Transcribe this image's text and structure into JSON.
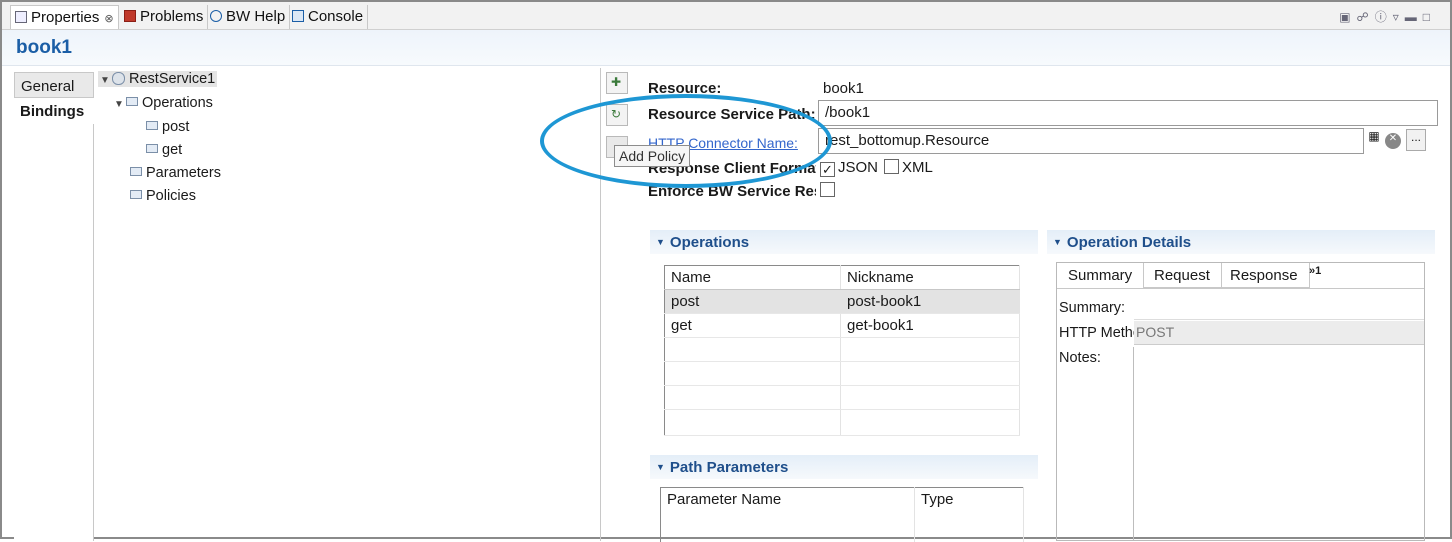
{
  "view_tabs": [
    {
      "label": "Properties",
      "close": "⊗",
      "active": true
    },
    {
      "label": "Problems"
    },
    {
      "label": "BW Help"
    },
    {
      "label": "Console"
    }
  ],
  "top_icons": [
    "view-menu-icon",
    "pin-icon",
    "help-icon",
    "minimize-icon",
    "maximize-icon"
  ],
  "title": "book1",
  "left_tabs": [
    "General",
    "Bindings"
  ],
  "tree": [
    {
      "label": "RestService1",
      "level": 0,
      "icon": "rest-service-icon",
      "expanded": true,
      "selected": true
    },
    {
      "label": "Operations",
      "level": 1,
      "icon": "operations-icon",
      "expanded": true
    },
    {
      "label": "post",
      "level": 2,
      "icon": "operation-icon"
    },
    {
      "label": "get",
      "level": 2,
      "icon": "operation-icon"
    },
    {
      "label": "Parameters",
      "level": 1,
      "icon": "parameters-icon"
    },
    {
      "label": "Policies",
      "level": 1,
      "icon": "policies-icon"
    }
  ],
  "tooltip": "Add Policy",
  "form": {
    "resource_label": "Resource:",
    "resource_value": "book1",
    "path_label": "Resource Service Path:",
    "path_value": "/book1",
    "connector_label": "HTTP Connector Name:",
    "connector_value": "rest_bottomup.Resource",
    "format_label": "Response Client Format",
    "json_label": "JSON",
    "json_checked": true,
    "xml_label": "XML",
    "xml_checked": false,
    "enforce_label": "Enforce BW Service Res",
    "enforce_checked": false,
    "browse_label": "..."
  },
  "operations_section": {
    "title": "Operations",
    "columns": [
      "Name",
      "Nickname"
    ],
    "rows": [
      {
        "name": "post",
        "nickname": "post-book1",
        "selected": true
      },
      {
        "name": "get",
        "nickname": "get-book1",
        "selected": false
      }
    ]
  },
  "path_params_section": {
    "title": "Path Parameters",
    "columns": [
      "Parameter Name",
      "Type"
    ]
  },
  "details_section": {
    "title": "Operation Details",
    "tabs": [
      "Summary",
      "Request",
      "Response"
    ],
    "overflow": "»1",
    "summary_label": "Summary:",
    "summary_value": "",
    "method_label": "HTTP Method:",
    "method_value": "POST",
    "notes_label": "Notes:"
  },
  "colors": {
    "accent": "#1b5ea6",
    "highlight_circle": "#1e97d4"
  }
}
